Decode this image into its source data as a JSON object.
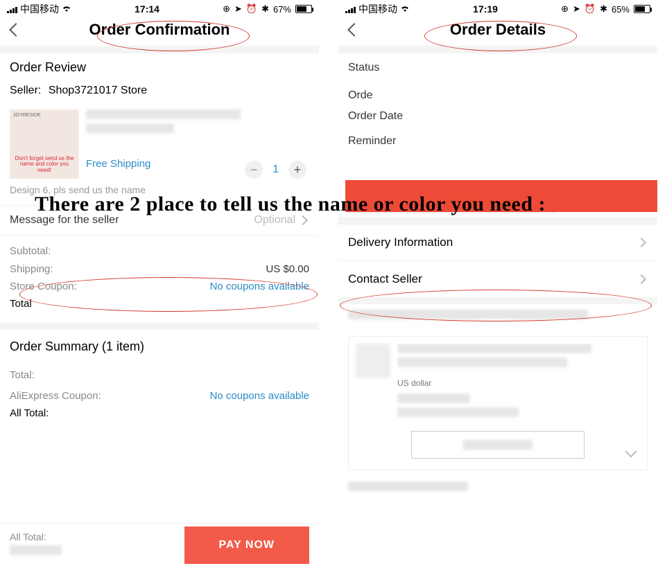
{
  "left": {
    "status": {
      "carrier": "中国移动",
      "time": "17:14",
      "battery": "67%"
    },
    "header": {
      "title": "Order Confirmation"
    },
    "review": {
      "title": "Order Review",
      "seller_label": "Seller:",
      "seller_name": "Shop3721017 Store",
      "thumb_caption": "Don't forget send us the name and color you need!",
      "free_shipping": "Free Shipping",
      "quantity": "1",
      "design_note": "Design 6, pls send us the name"
    },
    "message_row": {
      "label": "Message for the seller",
      "hint": "Optional"
    },
    "totals": {
      "subtotal_label": "Subtotal:",
      "shipping_label": "Shipping:",
      "shipping_value": "US $0.00",
      "coupon_label": "Store Coupon:",
      "coupon_value": "No coupons available",
      "total_label": "Total"
    },
    "summary": {
      "title": "Order Summary (1 item)",
      "total_label": "Total:",
      "ali_coupon_label": "AliExpress Coupon:",
      "ali_coupon_value": "No coupons available",
      "all_total_label": "All Total:"
    },
    "paybar": {
      "all_total_label": "All Total:",
      "button": "PAY NOW"
    }
  },
  "right": {
    "status": {
      "carrier": "中国移动",
      "time": "17:19",
      "battery": "65%"
    },
    "header": {
      "title": "Order Details"
    },
    "fields": {
      "status_label": "Status",
      "order_label": "Orde",
      "order_date_label": "Order Date",
      "reminder_label": "Reminder"
    },
    "nav": {
      "delivery": "Delivery Information",
      "contact": "Contact Seller"
    },
    "card": {
      "currency_note": "US dollar"
    }
  },
  "overlay": {
    "text": "There are 2 place to tell us the name or color you need :"
  }
}
